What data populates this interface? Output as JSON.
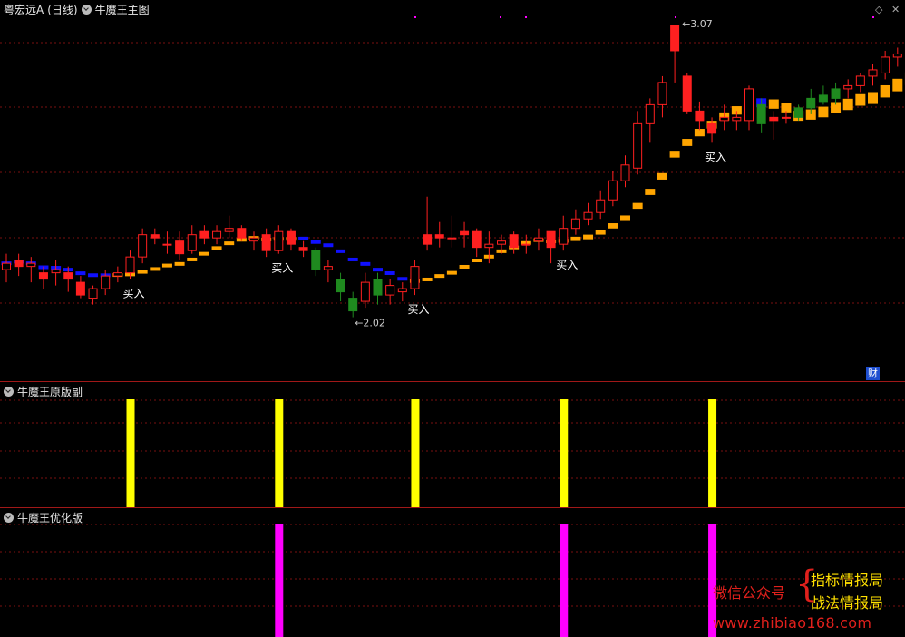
{
  "main": {
    "title_stock": "粤宏远A",
    "title_period": "(日线)",
    "title_indicator": "牛魔王主图",
    "high_label": "3.07",
    "low_label": "2.02",
    "buy_label": "买入",
    "cai_label": "财"
  },
  "sub1": {
    "title": "牛魔王原版副"
  },
  "sub2": {
    "title": "牛魔王优化版"
  },
  "watermark": {
    "line1": "微信公众号",
    "line2": "指标情报局",
    "line3": "战法情报局",
    "url": "www.zhibiao168.com"
  },
  "colors": {
    "up": "#ff2020",
    "down_red": "#ff1010",
    "green": "#1f8a1f",
    "orange": "#ffa500",
    "blue": "#1010ff",
    "yellow_bar": "#ffff00",
    "magenta_bar": "#ff00ff",
    "grid": "#7a0f0f"
  },
  "chart_data": {
    "type": "candlestick",
    "price_high": 3.07,
    "price_low": 2.02,
    "candles": [
      {
        "o": 2.3,
        "c": 2.32,
        "h": 2.35,
        "l": 2.26,
        "k": "up"
      },
      {
        "o": 2.31,
        "c": 2.33,
        "h": 2.35,
        "l": 2.28,
        "k": "down"
      },
      {
        "o": 2.32,
        "c": 2.31,
        "h": 2.34,
        "l": 2.26,
        "k": "up"
      },
      {
        "o": 2.29,
        "c": 2.27,
        "h": 2.31,
        "l": 2.24,
        "k": "down"
      },
      {
        "o": 2.29,
        "c": 2.3,
        "h": 2.33,
        "l": 2.25,
        "k": "up"
      },
      {
        "o": 2.29,
        "c": 2.27,
        "h": 2.31,
        "l": 2.23,
        "k": "down"
      },
      {
        "o": 2.26,
        "c": 2.22,
        "h": 2.28,
        "l": 2.21,
        "k": "down"
      },
      {
        "o": 2.21,
        "c": 2.24,
        "h": 2.25,
        "l": 2.19,
        "k": "up"
      },
      {
        "o": 2.24,
        "c": 2.28,
        "h": 2.3,
        "l": 2.22,
        "k": "up"
      },
      {
        "o": 2.28,
        "c": 2.29,
        "h": 2.31,
        "l": 2.26,
        "k": "up"
      },
      {
        "o": 2.29,
        "c": 2.34,
        "h": 2.36,
        "l": 2.27,
        "k": "up"
      },
      {
        "o": 2.34,
        "c": 2.41,
        "h": 2.43,
        "l": 2.32,
        "k": "up"
      },
      {
        "o": 2.41,
        "c": 2.4,
        "h": 2.43,
        "l": 2.38,
        "k": "down"
      },
      {
        "o": 2.38,
        "c": 2.38,
        "h": 2.42,
        "l": 2.35,
        "k": "up"
      },
      {
        "o": 2.39,
        "c": 2.35,
        "h": 2.42,
        "l": 2.33,
        "k": "down"
      },
      {
        "o": 2.36,
        "c": 2.41,
        "h": 2.44,
        "l": 2.35,
        "k": "up"
      },
      {
        "o": 2.42,
        "c": 2.4,
        "h": 2.44,
        "l": 2.38,
        "k": "down"
      },
      {
        "o": 2.4,
        "c": 2.42,
        "h": 2.44,
        "l": 2.38,
        "k": "up"
      },
      {
        "o": 2.42,
        "c": 2.43,
        "h": 2.47,
        "l": 2.4,
        "k": "up"
      },
      {
        "o": 2.43,
        "c": 2.4,
        "h": 2.44,
        "l": 2.39,
        "k": "down"
      },
      {
        "o": 2.39,
        "c": 2.4,
        "h": 2.42,
        "l": 2.36,
        "k": "up"
      },
      {
        "o": 2.41,
        "c": 2.36,
        "h": 2.43,
        "l": 2.34,
        "k": "down"
      },
      {
        "o": 2.36,
        "c": 2.42,
        "h": 2.44,
        "l": 2.35,
        "k": "up"
      },
      {
        "o": 2.42,
        "c": 2.38,
        "h": 2.43,
        "l": 2.36,
        "k": "down"
      },
      {
        "o": 2.37,
        "c": 2.36,
        "h": 2.39,
        "l": 2.34,
        "k": "down"
      },
      {
        "o": 2.36,
        "c": 2.3,
        "h": 2.37,
        "l": 2.28,
        "k": "green"
      },
      {
        "o": 2.31,
        "c": 2.3,
        "h": 2.33,
        "l": 2.26,
        "k": "up"
      },
      {
        "o": 2.27,
        "c": 2.23,
        "h": 2.29,
        "l": 2.2,
        "k": "green"
      },
      {
        "o": 2.21,
        "c": 2.17,
        "h": 2.23,
        "l": 2.15,
        "k": "green"
      },
      {
        "o": 2.2,
        "c": 2.26,
        "h": 2.29,
        "l": 2.18,
        "k": "up"
      },
      {
        "o": 2.27,
        "c": 2.22,
        "h": 2.29,
        "l": 2.19,
        "k": "green"
      },
      {
        "o": 2.22,
        "c": 2.25,
        "h": 2.27,
        "l": 2.19,
        "k": "up"
      },
      {
        "o": 2.23,
        "c": 2.24,
        "h": 2.26,
        "l": 2.2,
        "k": "up"
      },
      {
        "o": 2.24,
        "c": 2.31,
        "h": 2.33,
        "l": 2.22,
        "k": "up"
      },
      {
        "o": 2.38,
        "c": 2.41,
        "h": 2.53,
        "l": 2.36,
        "k": "down"
      },
      {
        "o": 2.4,
        "c": 2.41,
        "h": 2.45,
        "l": 2.37,
        "k": "down"
      },
      {
        "o": 2.4,
        "c": 2.4,
        "h": 2.47,
        "l": 2.37,
        "k": "up"
      },
      {
        "o": 2.41,
        "c": 2.42,
        "h": 2.45,
        "l": 2.37,
        "k": "down"
      },
      {
        "o": 2.42,
        "c": 2.37,
        "h": 2.43,
        "l": 2.34,
        "k": "down"
      },
      {
        "o": 2.37,
        "c": 2.38,
        "h": 2.42,
        "l": 2.32,
        "k": "up"
      },
      {
        "o": 2.38,
        "c": 2.39,
        "h": 2.41,
        "l": 2.35,
        "k": "up"
      },
      {
        "o": 2.41,
        "c": 2.37,
        "h": 2.42,
        "l": 2.35,
        "k": "down"
      },
      {
        "o": 2.38,
        "c": 2.38,
        "h": 2.41,
        "l": 2.35,
        "k": "up"
      },
      {
        "o": 2.39,
        "c": 2.4,
        "h": 2.43,
        "l": 2.36,
        "k": "up"
      },
      {
        "o": 2.42,
        "c": 2.37,
        "h": 2.42,
        "l": 2.32,
        "k": "down"
      },
      {
        "o": 2.38,
        "c": 2.43,
        "h": 2.47,
        "l": 2.36,
        "k": "up"
      },
      {
        "o": 2.43,
        "c": 2.46,
        "h": 2.49,
        "l": 2.41,
        "k": "up"
      },
      {
        "o": 2.46,
        "c": 2.48,
        "h": 2.51,
        "l": 2.44,
        "k": "up"
      },
      {
        "o": 2.48,
        "c": 2.52,
        "h": 2.55,
        "l": 2.46,
        "k": "up"
      },
      {
        "o": 2.52,
        "c": 2.58,
        "h": 2.61,
        "l": 2.5,
        "k": "up"
      },
      {
        "o": 2.58,
        "c": 2.63,
        "h": 2.66,
        "l": 2.56,
        "k": "up"
      },
      {
        "o": 2.62,
        "c": 2.76,
        "h": 2.8,
        "l": 2.6,
        "k": "up"
      },
      {
        "o": 2.76,
        "c": 2.82,
        "h": 2.84,
        "l": 2.7,
        "k": "up"
      },
      {
        "o": 2.82,
        "c": 2.89,
        "h": 2.91,
        "l": 2.78,
        "k": "up"
      },
      {
        "o": 2.99,
        "c": 3.07,
        "h": 3.07,
        "l": 2.89,
        "k": "down"
      },
      {
        "o": 2.91,
        "c": 2.8,
        "h": 2.92,
        "l": 2.79,
        "k": "down"
      },
      {
        "o": 2.8,
        "c": 2.77,
        "h": 2.83,
        "l": 2.74,
        "k": "down"
      },
      {
        "o": 2.76,
        "c": 2.73,
        "h": 2.78,
        "l": 2.7,
        "k": "down"
      },
      {
        "o": 2.77,
        "c": 2.78,
        "h": 2.82,
        "l": 2.74,
        "k": "up"
      },
      {
        "o": 2.78,
        "c": 2.77,
        "h": 2.8,
        "l": 2.74,
        "k": "up"
      },
      {
        "o": 2.77,
        "c": 2.87,
        "h": 2.88,
        "l": 2.74,
        "k": "up"
      },
      {
        "o": 2.82,
        "c": 2.76,
        "h": 2.84,
        "l": 2.73,
        "k": "green"
      },
      {
        "o": 2.77,
        "c": 2.78,
        "h": 2.8,
        "l": 2.71,
        "k": "down"
      },
      {
        "o": 2.78,
        "c": 2.78,
        "h": 2.8,
        "l": 2.76,
        "k": "up"
      },
      {
        "o": 2.78,
        "c": 2.81,
        "h": 2.82,
        "l": 2.77,
        "k": "green"
      },
      {
        "o": 2.81,
        "c": 2.84,
        "h": 2.87,
        "l": 2.79,
        "k": "green"
      },
      {
        "o": 2.83,
        "c": 2.85,
        "h": 2.88,
        "l": 2.82,
        "k": "green"
      },
      {
        "o": 2.84,
        "c": 2.87,
        "h": 2.89,
        "l": 2.82,
        "k": "green"
      },
      {
        "o": 2.87,
        "c": 2.88,
        "h": 2.9,
        "l": 2.84,
        "k": "up"
      },
      {
        "o": 2.88,
        "c": 2.91,
        "h": 2.92,
        "l": 2.86,
        "k": "up"
      },
      {
        "o": 2.91,
        "c": 2.93,
        "h": 2.95,
        "l": 2.88,
        "k": "up"
      },
      {
        "o": 2.92,
        "c": 2.97,
        "h": 2.99,
        "l": 2.9,
        "k": "up"
      },
      {
        "o": 2.97,
        "c": 2.98,
        "h": 3.0,
        "l": 2.94,
        "k": "up"
      },
      {
        "o": 2.98,
        "c": 2.98,
        "h": 3.01,
        "l": 2.95,
        "k": "down"
      }
    ],
    "band_colors": [
      "blue",
      "blue",
      "blue",
      "blue",
      "blue",
      "blue",
      "blue",
      "blue",
      "blue",
      "orange",
      "orange",
      "orange",
      "orange",
      "orange",
      "orange",
      "orange",
      "orange",
      "orange",
      "orange",
      "orange",
      "orange",
      "orange",
      "orange",
      "orange",
      "blue",
      "blue",
      "blue",
      "blue",
      "blue",
      "blue",
      "blue",
      "blue",
      "blue",
      "orange",
      "orange",
      "orange",
      "orange",
      "orange",
      "orange",
      "orange",
      "orange",
      "orange",
      "orange",
      "orange",
      "orange",
      "orange",
      "orange",
      "orange",
      "orange",
      "orange",
      "orange",
      "orange",
      "orange",
      "orange",
      "orange",
      "orange",
      "orange",
      "orange",
      "orange",
      "orange",
      "orange",
      "blue",
      "orange",
      "orange",
      "orange",
      "orange",
      "orange",
      "orange",
      "orange",
      "orange",
      "orange",
      "orange",
      "orange",
      "orange"
    ],
    "buy_signals_index": [
      10,
      22,
      33,
      45,
      57
    ],
    "sub1_signals_index": [
      10,
      22,
      33,
      45,
      57
    ],
    "sub2_signals_index": [
      22,
      45,
      57
    ]
  }
}
